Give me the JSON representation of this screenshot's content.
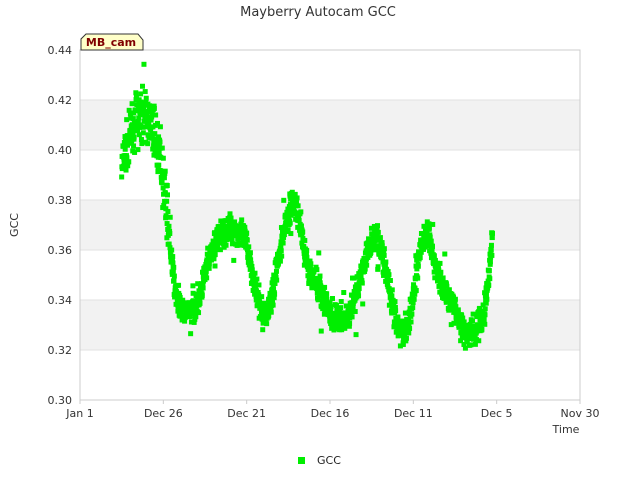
{
  "chart_data": {
    "type": "scatter",
    "title": "Mayberry Autocam GCC",
    "xlabel": "Time",
    "ylabel": "GCC",
    "ylim": [
      0.3,
      0.44
    ],
    "yticks": [
      "0.30",
      "0.32",
      "0.34",
      "0.36",
      "0.38",
      "0.40",
      "0.42",
      "0.44"
    ],
    "xticks": [
      "Jan 1",
      "Dec 26",
      "Dec 21",
      "Dec 16",
      "Dec 11",
      "Dec 5",
      "Nov 30"
    ],
    "grid": "alternating horizontal bands",
    "legend_position": "bottom-center",
    "flag_label": "MB_cam",
    "series": [
      {
        "name": "GCC",
        "color": "#00ee00",
        "x_unit": "days from Jan 1 (axis reversed, Jan 1 at left)",
        "trend": [
          [
            10,
            0.392
          ],
          [
            11,
            0.4
          ],
          [
            12,
            0.405
          ],
          [
            13,
            0.41
          ],
          [
            14,
            0.413
          ],
          [
            15,
            0.414
          ],
          [
            16,
            0.413
          ],
          [
            17,
            0.41
          ],
          [
            18,
            0.405
          ],
          [
            19,
            0.398
          ],
          [
            20,
            0.39
          ],
          [
            21,
            0.375
          ],
          [
            22,
            0.355
          ],
          [
            23,
            0.342
          ],
          [
            24,
            0.337
          ],
          [
            25,
            0.336
          ],
          [
            26,
            0.336
          ],
          [
            27,
            0.336
          ],
          [
            28,
            0.338
          ],
          [
            29,
            0.343
          ],
          [
            30,
            0.35
          ],
          [
            31,
            0.356
          ],
          [
            32,
            0.361
          ],
          [
            33,
            0.364
          ],
          [
            34,
            0.366
          ],
          [
            35,
            0.367
          ],
          [
            36,
            0.368
          ],
          [
            37,
            0.368
          ],
          [
            38,
            0.367
          ],
          [
            39,
            0.366
          ],
          [
            40,
            0.362
          ],
          [
            41,
            0.354
          ],
          [
            42,
            0.345
          ],
          [
            43,
            0.338
          ],
          [
            44,
            0.334
          ],
          [
            45,
            0.335
          ],
          [
            46,
            0.34
          ],
          [
            47,
            0.35
          ],
          [
            48,
            0.36
          ],
          [
            49,
            0.368
          ],
          [
            50,
            0.375
          ],
          [
            51,
            0.379
          ],
          [
            52,
            0.377
          ],
          [
            53,
            0.368
          ],
          [
            54,
            0.358
          ],
          [
            55,
            0.352
          ],
          [
            56,
            0.349
          ],
          [
            57,
            0.346
          ],
          [
            58,
            0.343
          ],
          [
            59,
            0.339
          ],
          [
            60,
            0.335
          ],
          [
            61,
            0.333
          ],
          [
            62,
            0.332
          ],
          [
            63,
            0.332
          ],
          [
            64,
            0.333
          ],
          [
            65,
            0.336
          ],
          [
            66,
            0.341
          ],
          [
            67,
            0.347
          ],
          [
            68,
            0.353
          ],
          [
            69,
            0.359
          ],
          [
            70,
            0.364
          ],
          [
            71,
            0.366
          ],
          [
            72,
            0.362
          ],
          [
            73,
            0.355
          ],
          [
            74,
            0.346
          ],
          [
            75,
            0.337
          ],
          [
            76,
            0.33
          ],
          [
            77,
            0.327
          ],
          [
            78,
            0.328
          ],
          [
            79,
            0.333
          ],
          [
            80,
            0.342
          ],
          [
            81,
            0.353
          ],
          [
            82,
            0.362
          ],
          [
            83,
            0.366
          ],
          [
            84,
            0.363
          ],
          [
            85,
            0.356
          ],
          [
            86,
            0.35
          ],
          [
            87,
            0.346
          ],
          [
            88,
            0.343
          ],
          [
            89,
            0.34
          ],
          [
            90,
            0.336
          ],
          [
            91,
            0.331
          ],
          [
            92,
            0.328
          ],
          [
            93,
            0.327
          ],
          [
            94,
            0.328
          ],
          [
            95,
            0.329
          ],
          [
            96,
            0.331
          ],
          [
            97,
            0.335
          ],
          [
            98,
            0.348
          ],
          [
            99,
            0.365
          ]
        ]
      }
    ]
  }
}
